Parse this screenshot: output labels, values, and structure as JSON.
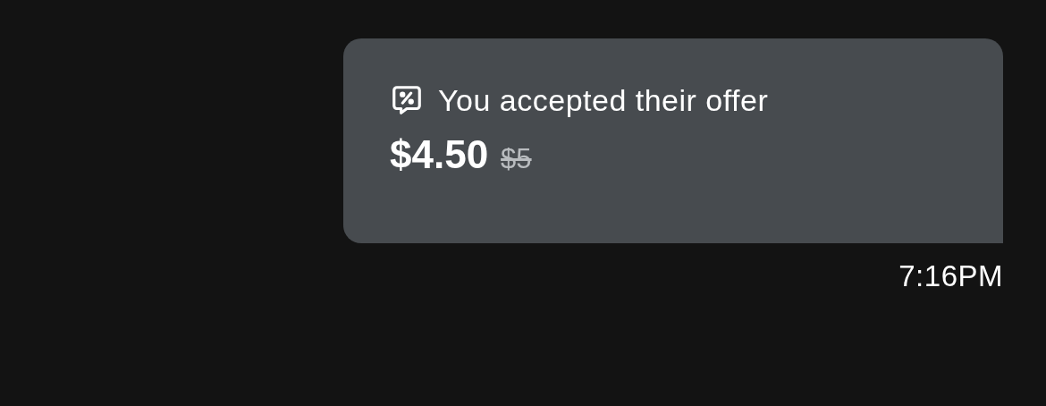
{
  "message": {
    "title": "You accepted their offer",
    "price": "$4.50",
    "original_price": "$5",
    "time": "7:16PM"
  }
}
